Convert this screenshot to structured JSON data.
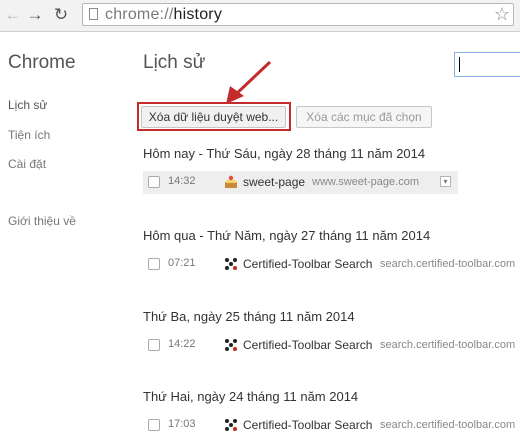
{
  "browser": {
    "url_scheme": "chrome://",
    "url_path": "history",
    "back_icon": "arrow-right",
    "reload_icon": "reload",
    "star_icon": "star"
  },
  "sidebar": {
    "title": "Chrome",
    "items": [
      {
        "label": "Lịch sử"
      },
      {
        "label": "Tiện ích"
      },
      {
        "label": "Cài đặt"
      },
      {
        "label": "Giới thiệu về"
      }
    ]
  },
  "main": {
    "title": "Lịch sử",
    "clear_button": "Xóa dữ liệu duyệt web...",
    "remove_button": "Xóa các mục đã chọn",
    "accent_color": "#c42b2b",
    "groups": [
      {
        "date": "Hôm nay - Thứ Sáu, ngày 28 tháng 11 năm 2014",
        "entries": [
          {
            "time": "14:32",
            "title": "sweet-page",
            "domain": "www.sweet-page.com"
          }
        ]
      },
      {
        "date": "Hôm qua - Thứ Năm, ngày 27 tháng 11 năm 2014",
        "entries": [
          {
            "time": "07:21",
            "title": "Certified-Toolbar Search",
            "domain": "search.certified-toolbar.com"
          }
        ]
      },
      {
        "date": "Thứ Ba, ngày 25 tháng 11 năm 2014",
        "entries": [
          {
            "time": "14:22",
            "title": "Certified-Toolbar Search",
            "domain": "search.certified-toolbar.com"
          }
        ]
      },
      {
        "date": "Thứ Hai, ngày 24 tháng 11 năm 2014",
        "entries": [
          {
            "time": "17:03",
            "title": "Certified-Toolbar Search",
            "domain": "search.certified-toolbar.com"
          }
        ]
      }
    ]
  }
}
